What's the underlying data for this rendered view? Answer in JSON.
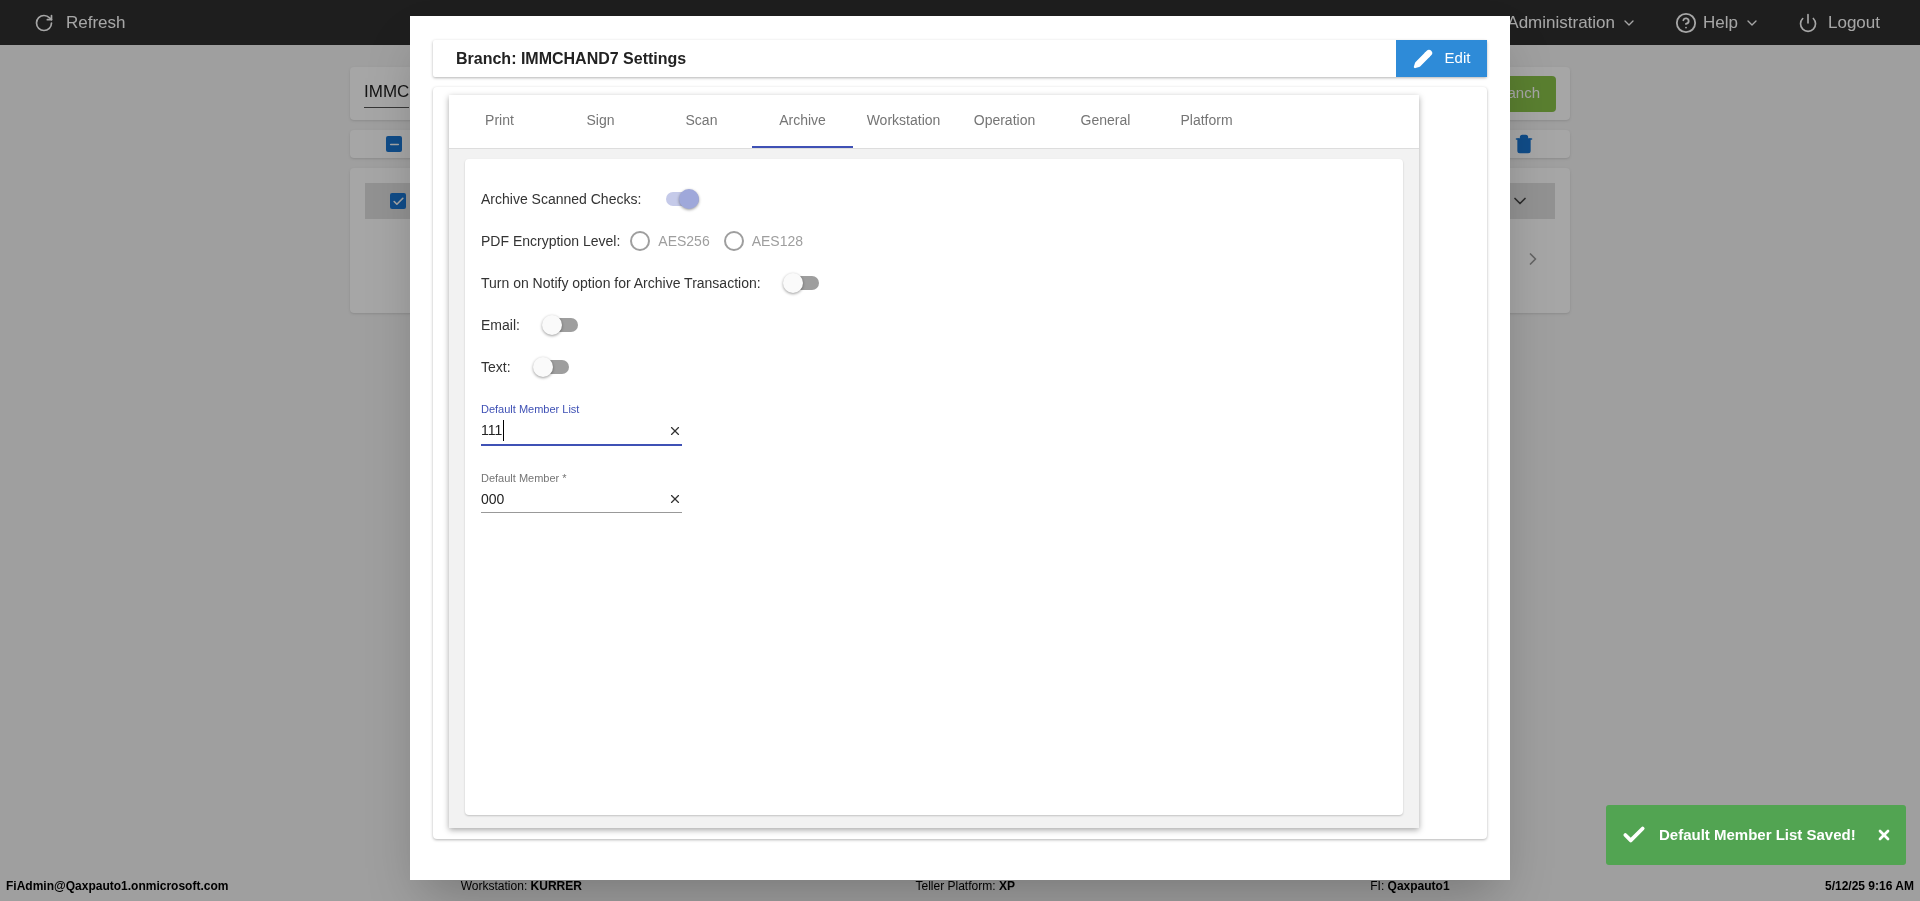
{
  "top_bar": {
    "refresh": "Refresh",
    "menus": [
      {
        "label": "Administration",
        "kind": "dropdown"
      },
      {
        "label": "Help",
        "kind": "dropdown"
      },
      {
        "label": "Logout",
        "kind": "logout"
      }
    ]
  },
  "background": {
    "search_value": "IMMC",
    "button_label": "anch"
  },
  "modal": {
    "title": "Branch: IMMCHAND7 Settings",
    "edit_label": "Edit",
    "tabs": [
      {
        "label": "Print",
        "selected": false
      },
      {
        "label": "Sign",
        "selected": false
      },
      {
        "label": "Scan",
        "selected": false
      },
      {
        "label": "Archive",
        "selected": true
      },
      {
        "label": "Workstation",
        "selected": false
      },
      {
        "label": "Operation",
        "selected": false
      },
      {
        "label": "General",
        "selected": false
      },
      {
        "label": "Platform",
        "selected": false
      }
    ],
    "settings": [
      {
        "kind": "toggle",
        "label": "Archive Scanned Checks:",
        "on": true
      },
      {
        "kind": "radio",
        "label": "PDF Encryption Level:",
        "options": [
          {
            "label": "AES256",
            "selected": false
          },
          {
            "label": "AES128",
            "selected": false
          }
        ]
      },
      {
        "kind": "toggle",
        "label": "Turn on Notify option for Archive Transaction:",
        "on": false
      },
      {
        "kind": "toggle",
        "label": "Email:",
        "on": false
      },
      {
        "kind": "toggle",
        "label": "Text:",
        "on": false
      }
    ],
    "fields": [
      {
        "label": "Default Member List",
        "value": "111",
        "focused": true
      },
      {
        "label": "Default Member *",
        "value": "000",
        "focused": false
      }
    ]
  },
  "status_bar": {
    "user": "FiAdmin@Qaxpauto1.onmicrosoft.com",
    "items": [
      {
        "label": "Workstation:",
        "value": "KURRER"
      },
      {
        "label": "Teller Platform:",
        "value": "XP"
      },
      {
        "label": "FI:",
        "value": "Qaxpauto1"
      }
    ],
    "datetime": "5/12/25 9:16 AM"
  },
  "toast": {
    "message": "Default Member List Saved!"
  }
}
